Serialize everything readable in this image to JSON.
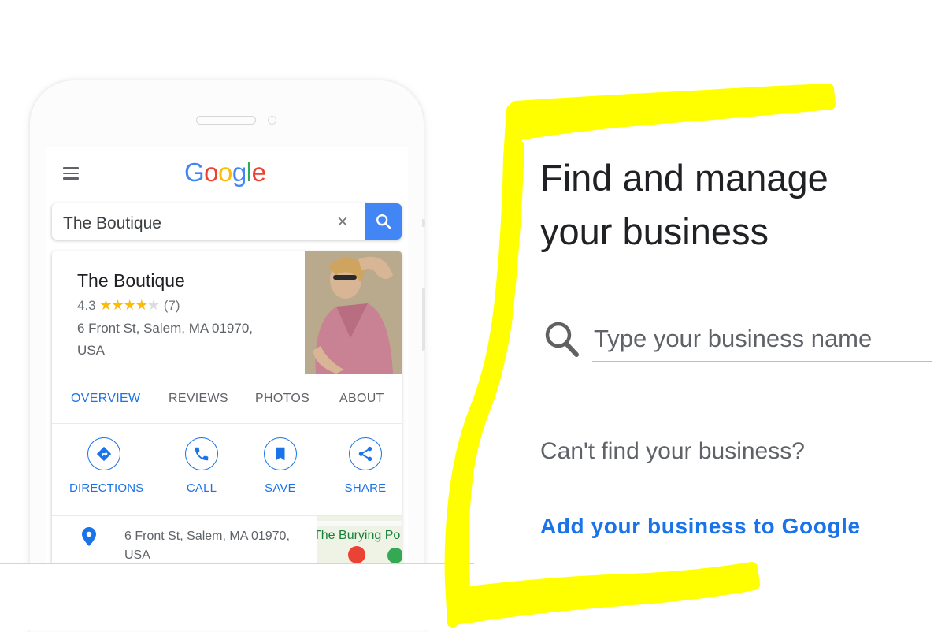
{
  "phone": {
    "logo_letters": [
      {
        "char": "G",
        "color": "#4285f4"
      },
      {
        "char": "o",
        "color": "#ea4335"
      },
      {
        "char": "o",
        "color": "#fbbc04"
      },
      {
        "char": "g",
        "color": "#4285f4"
      },
      {
        "char": "l",
        "color": "#34a853"
      },
      {
        "char": "e",
        "color": "#ea4335"
      }
    ],
    "search": {
      "value": "The Boutique",
      "clear_glyph": "×"
    },
    "business": {
      "name": "The Boutique",
      "rating": "4.3",
      "stars_filled": "★★★★",
      "stars_empty": "★",
      "review_count": "(7)",
      "address_line1": "6 Front St, Salem, MA 01970,",
      "address_line2": "USA"
    },
    "tabs": [
      {
        "label": "OVERVIEW",
        "active": true
      },
      {
        "label": "REVIEWS",
        "active": false
      },
      {
        "label": "PHOTOS",
        "active": false
      },
      {
        "label": "ABOUT",
        "active": false
      }
    ],
    "actions": [
      {
        "label": "DIRECTIONS",
        "icon": "directions-icon"
      },
      {
        "label": "CALL",
        "icon": "phone-icon"
      },
      {
        "label": "SAVE",
        "icon": "bookmark-icon"
      },
      {
        "label": "SHARE",
        "icon": "share-icon"
      }
    ],
    "info": {
      "address_line1": "6 Front St, Salem, MA 01970,",
      "address_line2": "USA",
      "map_label": "The Burying Po"
    }
  },
  "panel": {
    "headline_line1": "Find and manage",
    "headline_line2": "your business",
    "search_placeholder": "Type your business name",
    "cant_find": "Can't find your business?",
    "add_link": "Add your business to Google"
  },
  "colors": {
    "accent": "#1a73e8",
    "highlight": "#ffff00",
    "star": "#fbbc04"
  }
}
